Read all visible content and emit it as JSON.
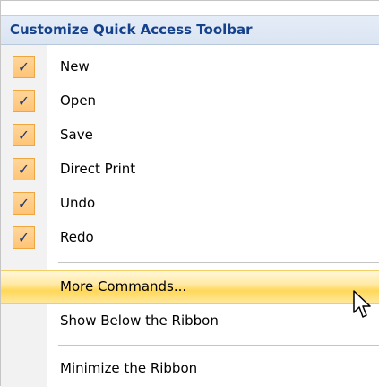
{
  "menu": {
    "title": "Customize Quick Access Toolbar",
    "check_glyph": "✓",
    "checked_items": [
      {
        "label": "New"
      },
      {
        "label": "Open"
      },
      {
        "label": "Save"
      },
      {
        "label": "Direct Print"
      },
      {
        "label": "Undo"
      },
      {
        "label": "Redo"
      }
    ],
    "more_commands": "More Commands...",
    "show_below": "Show Below the Ribbon",
    "minimize": "Minimize the Ribbon"
  },
  "colors": {
    "header_text": "#15428b",
    "check_bg": "#ffc477",
    "highlight": "#ffd758"
  }
}
